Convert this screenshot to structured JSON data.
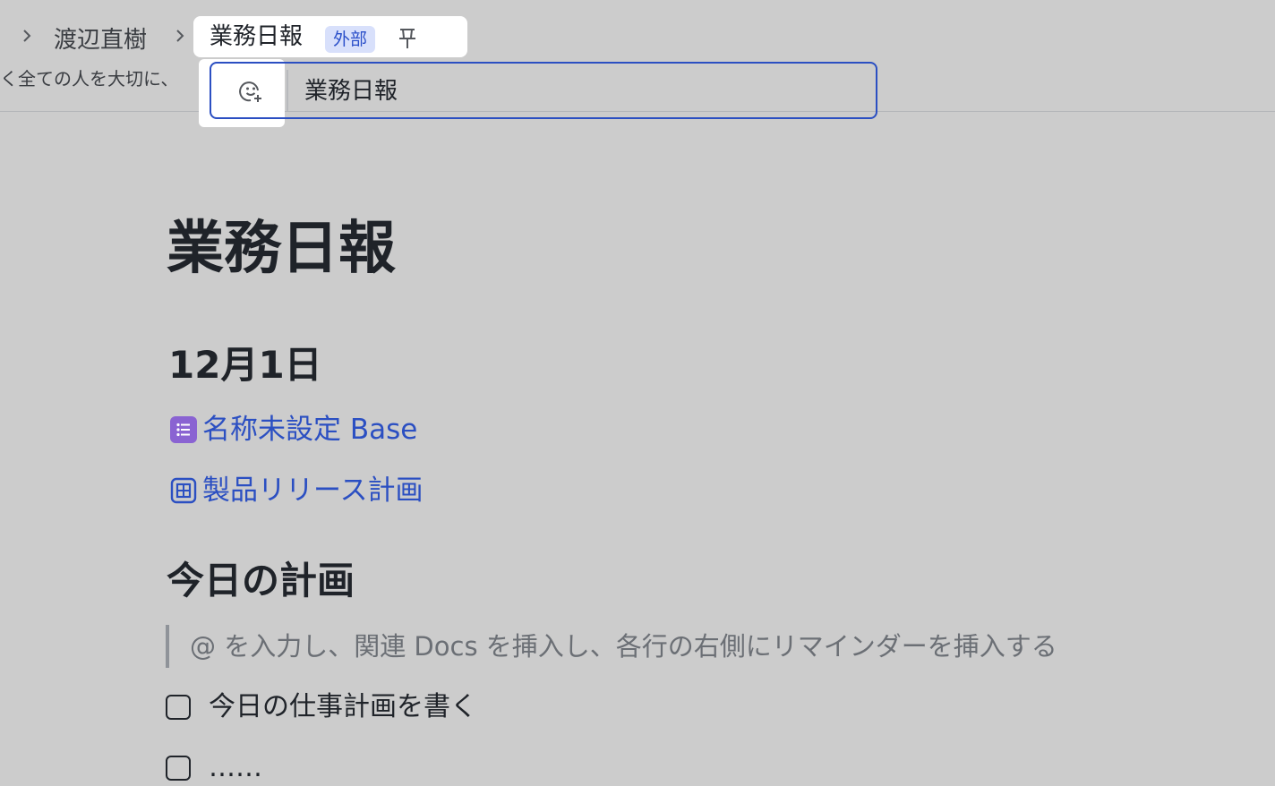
{
  "header": {
    "breadcrumbs": [
      "渡辺直樹"
    ],
    "subtitle": "く全ての人を大切に、",
    "tab": {
      "title": "業務日報",
      "badge": "外部"
    },
    "title_input": {
      "value": "業務日報"
    }
  },
  "document": {
    "title": "業務日報",
    "date_heading": "12月1日",
    "links": [
      {
        "label": "名称未設定 Base",
        "icon": "base-list-icon"
      },
      {
        "label": "製品リリース計画",
        "icon": "board-grid-icon"
      }
    ],
    "plan_heading": "今日の計画",
    "quote_placeholder": "@ を入力し、関連 Docs を挿入し、各行の右側にリマインダーを挿入する",
    "todos": [
      {
        "text": "今日の仕事計画を書く",
        "checked": false
      },
      {
        "text": "……",
        "checked": false
      }
    ]
  },
  "colors": {
    "accent": "#2b4fc2",
    "badge_bg": "#d8e0fb",
    "base_icon": "#8a63d2",
    "page_bg": "#cccccc"
  }
}
